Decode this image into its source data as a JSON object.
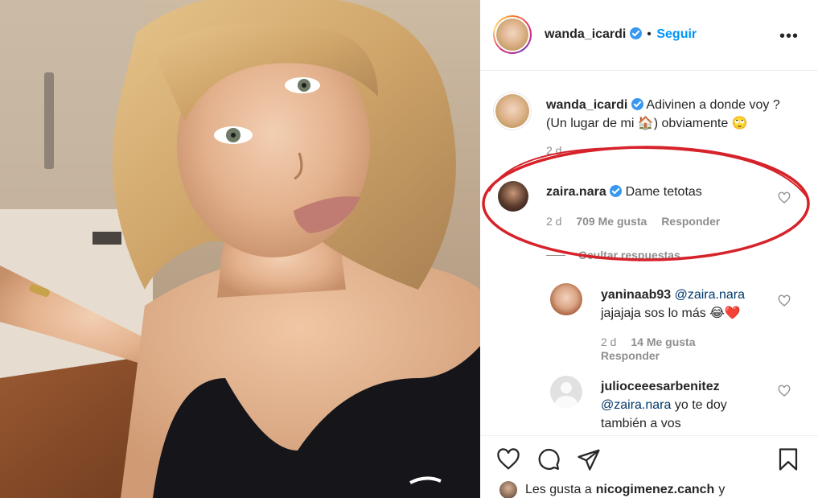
{
  "post": {
    "author": "wanda_icardi",
    "follow_label": "Seguir",
    "more_icon": "more-options-icon",
    "caption": "Adivinen a donde voy ? (Un lugar de mi 🏠) obviamente 🙄",
    "caption_time": "2 d"
  },
  "comments": [
    {
      "username": "zaira.nara",
      "verified": true,
      "text": "Dame tetotas",
      "time": "2 d",
      "likes": "709 Me gusta",
      "reply_label": "Responder",
      "hide_replies": "Ocultar respuestas",
      "replies": [
        {
          "username": "yaninaab93",
          "mention": "@zaira.nara",
          "text": "jajajaja sos lo más 😂❤️",
          "time": "2 d",
          "likes": "14 Me gusta",
          "reply_label": "Responder"
        },
        {
          "username": "julioceeesarbenitez",
          "mention": "@zaira.nara",
          "text": "yo te doy también a vos"
        }
      ]
    }
  ],
  "actions": {
    "like_icon": "heart-icon",
    "comment_icon": "comment-icon",
    "share_icon": "share-icon",
    "save_icon": "bookmark-icon"
  },
  "likes_line": {
    "prefix": "Les gusta a",
    "user": "nicogimenez.canch",
    "suffix": "y"
  },
  "colors": {
    "link": "#0095f6",
    "verified": "#3897f0",
    "annotation": "#d6222a"
  }
}
